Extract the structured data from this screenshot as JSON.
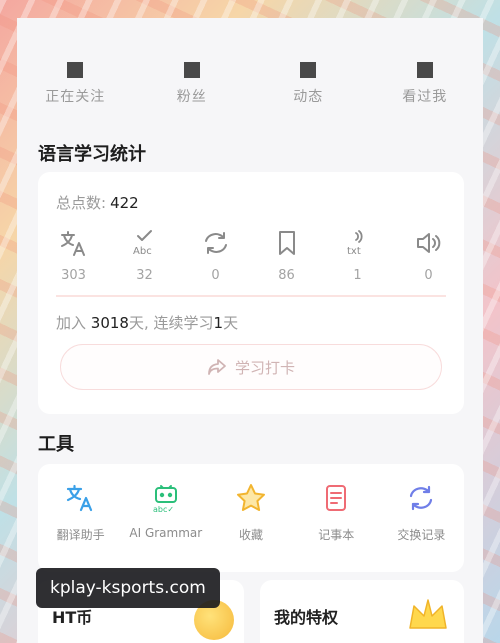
{
  "profile_stats": {
    "items": [
      {
        "label": "正在关注"
      },
      {
        "label": "粉丝"
      },
      {
        "label": "动态"
      },
      {
        "label": "看过我"
      }
    ]
  },
  "learning": {
    "title": "语言学习统计",
    "total_label": "总点数:",
    "total_value": "422",
    "metrics": [
      {
        "icon": "translate-icon",
        "value": "303"
      },
      {
        "icon": "abc-check-icon",
        "value": "32"
      },
      {
        "icon": "refresh-icon",
        "value": "0"
      },
      {
        "icon": "bookmark-icon",
        "value": "86"
      },
      {
        "icon": "txt-audio-icon",
        "value": "1"
      },
      {
        "icon": "speaker-icon",
        "value": "0"
      }
    ],
    "joined_prefix": "加入",
    "joined_days": "3018",
    "joined_mid": "天, 连续学习",
    "streak_days": "1",
    "joined_suffix": "天",
    "checkin_label": "学习打卡"
  },
  "tools": {
    "title": "工具",
    "items": [
      {
        "icon": "translate-assistant-icon",
        "label": "翻译助手",
        "color": "#3aa0e8"
      },
      {
        "icon": "ai-grammar-icon",
        "label": "AI Grammar",
        "color": "#2bbf7a"
      },
      {
        "icon": "star-icon",
        "label": "收藏",
        "color": "#f2b530"
      },
      {
        "icon": "notebook-icon",
        "label": "记事本",
        "color": "#ef6b74"
      },
      {
        "icon": "exchange-record-icon",
        "label": "交换记录",
        "color": "#6f7ee8"
      }
    ]
  },
  "bottom": {
    "ht_coin": "HT币",
    "privileges": "我的特权"
  },
  "watermark": "kplay-ksports.com"
}
